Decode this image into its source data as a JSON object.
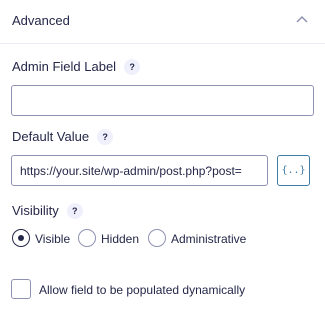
{
  "section": {
    "title": "Advanced",
    "toggle_icon": "chevron-up-icon"
  },
  "admin_field_label": {
    "label": "Admin Field Label",
    "help": "?",
    "value": ""
  },
  "default_value": {
    "label": "Default Value",
    "help": "?",
    "value": "https://your.site/wp-admin/post.php?post=",
    "merge_tag_button": "{..}"
  },
  "visibility": {
    "label": "Visibility",
    "help": "?",
    "options": [
      {
        "label": "Visible",
        "selected": true
      },
      {
        "label": "Hidden",
        "selected": false
      },
      {
        "label": "Administrative",
        "selected": false
      }
    ]
  },
  "dynamic_population": {
    "label": "Allow field to be populated dynamically",
    "checked": false
  },
  "colors": {
    "text": "#242748",
    "border": "#9092b2",
    "accent": "#3e7da6",
    "help_bg": "#eff0fb"
  }
}
